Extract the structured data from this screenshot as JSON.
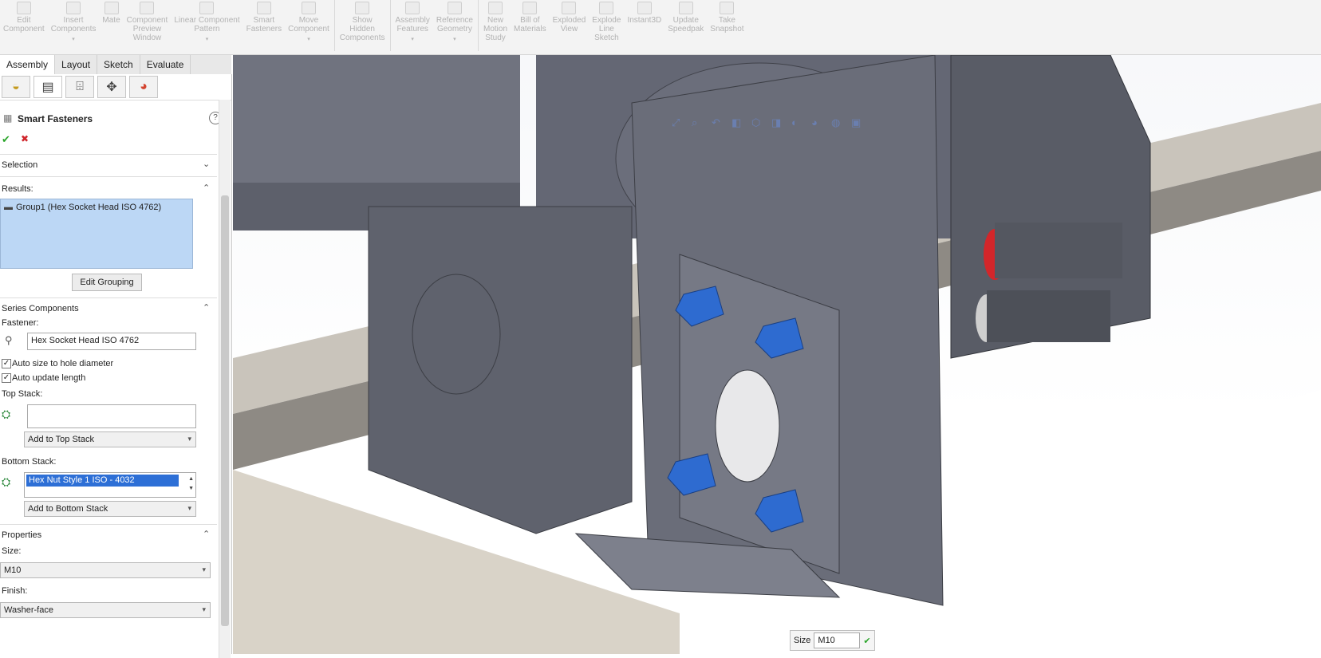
{
  "ribbon": [
    {
      "label": "Edit\nComponent",
      "dd": false
    },
    {
      "label": "Insert\nComponents",
      "dd": true
    },
    {
      "label": "Mate",
      "dd": false
    },
    {
      "label": "Component\nPreview\nWindow",
      "dd": false
    },
    {
      "label": "Linear Component\nPattern",
      "dd": true
    },
    {
      "label": "Smart\nFasteners",
      "dd": false
    },
    {
      "label": "Move\nComponent",
      "dd": true
    },
    {
      "sep": true
    },
    {
      "label": "Show\nHidden\nComponents",
      "dd": false
    },
    {
      "sep": true
    },
    {
      "label": "Assembly\nFeatures",
      "dd": true
    },
    {
      "label": "Reference\nGeometry",
      "dd": true
    },
    {
      "sep": true
    },
    {
      "label": "New\nMotion\nStudy",
      "dd": false
    },
    {
      "label": "Bill of\nMaterials",
      "dd": false
    },
    {
      "label": "Exploded\nView",
      "dd": false
    },
    {
      "label": "Explode\nLine\nSketch",
      "dd": false
    },
    {
      "label": "Instant3D",
      "dd": false
    },
    {
      "label": "Update\nSpeedpak",
      "dd": false
    },
    {
      "label": "Take\nSnapshot",
      "dd": false
    }
  ],
  "tabs": [
    "Assembly",
    "Layout",
    "Sketch",
    "Evaluate"
  ],
  "pm": {
    "title": "Smart Fasteners",
    "ok": "✔",
    "cancel": "✖",
    "help": "?",
    "selection": "Selection",
    "results": "Results:",
    "result_item": "Group1 (Hex Socket Head ISO 4762)",
    "edit_grouping": "Edit Grouping",
    "series": "Series Components",
    "fastener_label": "Fastener:",
    "fastener_value": "Hex Socket Head ISO 4762",
    "auto_size": "Auto size to hole diameter",
    "auto_len": "Auto update length",
    "top_stack": "Top Stack:",
    "top_stack_value": "",
    "add_top": "Add to Top Stack",
    "bottom_stack": "Bottom Stack:",
    "bottom_item": "Hex Nut Style 1 ISO - 4032",
    "add_bottom": "Add to Bottom Stack",
    "properties": "Properties",
    "size_label": "Size:",
    "size_value": "M10",
    "finish_label": "Finish:",
    "finish_value": "Washer-face"
  },
  "popup": {
    "label": "Size",
    "value": "M10",
    "ok": "✔"
  },
  "colors": {
    "accent": "#3a74c8",
    "part": "#6f7380",
    "bolt": "#2e6bd0",
    "select": "#bcd7f5"
  }
}
